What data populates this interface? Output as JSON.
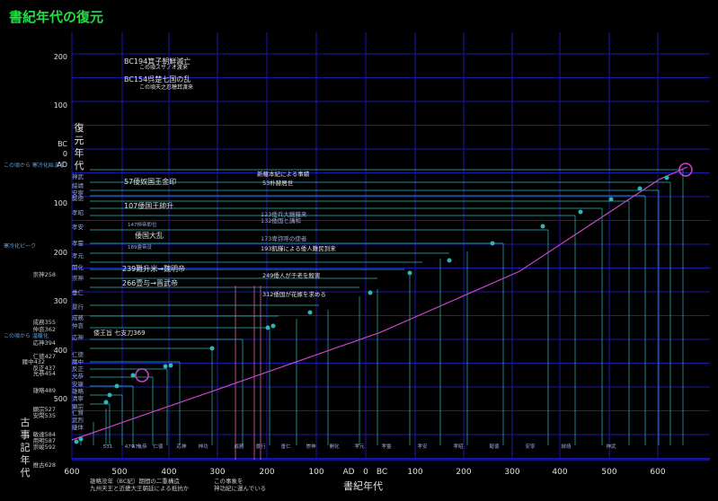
{
  "title": "書紀年代の復元",
  "colors": {
    "background": "#000000",
    "grid": "#1a1aa8",
    "title": "#22dd44",
    "axis_text": "#e0e0e0",
    "diagonal": "#cc44cc",
    "teal": "#2fb5b5",
    "note": "#c8c8c8"
  },
  "chart_data": {
    "type": "line",
    "title": "書紀年代の復元",
    "xlabel": "書紀年代",
    "ylabel_top": "復元年代",
    "ylabel_bottom": "古事記年代",
    "grid": true,
    "x_tick_labels": [
      "600",
      "500",
      "400",
      "300",
      "200",
      "100",
      "AD",
      "0",
      "BC",
      "100",
      "200",
      "300",
      "400",
      "500",
      "600"
    ],
    "y_tick_labels": [
      "200",
      "100",
      "BC",
      "0",
      "AD",
      "100",
      "200",
      "300",
      "400",
      "500"
    ],
    "series": [
      {
        "values": [
          [
            -660,
            -35
          ],
          [
            -300,
            60
          ],
          [
            0,
            140
          ],
          [
            300,
            240
          ],
          [
            600,
            390
          ],
          [
            660,
            410
          ]
        ]
      }
    ],
    "left_labels": [
      "神武",
      "綏靖",
      "安寧",
      "懿徳",
      "孝昭",
      "孝安",
      "孝霊",
      "孝元",
      "開化",
      "崇神",
      "垂仁",
      "景行",
      "成務",
      "仲哀",
      "応神",
      "仁徳",
      "履中",
      "反正",
      "允恭",
      "安康",
      "雄略",
      "清寧",
      "顕宗",
      "仁賢",
      "武烈",
      "継体"
    ],
    "kojiki_labels": [
      "崇神258",
      "成務355",
      "仲哀362",
      "応神394",
      "仁徳427",
      "履中432",
      "反正437",
      "允恭454",
      "雄略489",
      "顕宗527",
      "安閑535",
      "敏達584",
      "用明587",
      "崇峻592",
      "推古628"
    ],
    "left_notes": [
      "この頃から 寒冷化始まる",
      "寒冷化ピーク",
      "この頃から 温暖化"
    ],
    "events": [
      "BC194箕子朝鮮滅亡",
      "この頃スサノオ渡来",
      "BC154呉楚七国の乱",
      "この頃天之忍穂耳渡来",
      "57倭奴国王金印",
      "107倭国王帥升",
      "147桓帝即位",
      "倭国大乱",
      "189霊帝没",
      "239難升米→魏明帝",
      "266壹与→晋武帝",
      "倭王旨 七支刀369",
      "新羅本紀による事績",
      "53朴赫居世",
      "123倭兵大饑饉来",
      "132倭国と講和",
      "173卑弥呼の使者",
      "193飢饉による倭人難民到来",
      "249倭人が于老を殺害",
      "312倭国が花嫁を求める"
    ],
    "bottom_notes": [
      "雄略没年（BC紀）期間の二重構造",
      "九州天王と近畿大王朝廷による抵抗か",
      "この事象を",
      "神功紀に運んでいる"
    ],
    "bottom_axis_labels": [
      "531",
      "479",
      "470",
      "允恭",
      "仁徳",
      "応神",
      "神功",
      "成務",
      "景行",
      "垂仁",
      "崇神",
      "開化",
      "孝元",
      "孝霊",
      "孝安",
      "孝昭",
      "懿徳",
      "安寧",
      "綏靖",
      "神武"
    ]
  }
}
